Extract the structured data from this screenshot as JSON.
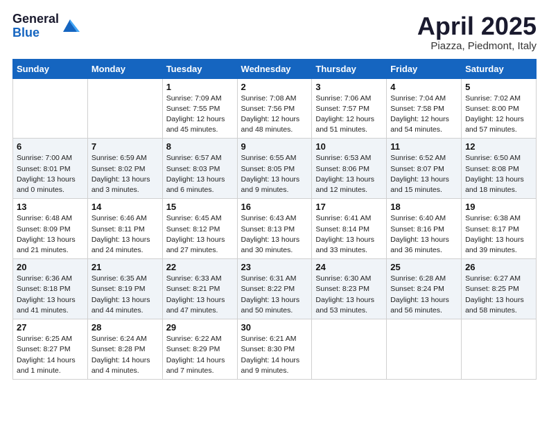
{
  "header": {
    "logo_general": "General",
    "logo_blue": "Blue",
    "title": "April 2025",
    "location": "Piazza, Piedmont, Italy"
  },
  "days_of_week": [
    "Sunday",
    "Monday",
    "Tuesday",
    "Wednesday",
    "Thursday",
    "Friday",
    "Saturday"
  ],
  "weeks": [
    [
      {
        "day": "",
        "info": ""
      },
      {
        "day": "",
        "info": ""
      },
      {
        "day": "1",
        "info": "Sunrise: 7:09 AM\nSunset: 7:55 PM\nDaylight: 12 hours and 45 minutes."
      },
      {
        "day": "2",
        "info": "Sunrise: 7:08 AM\nSunset: 7:56 PM\nDaylight: 12 hours and 48 minutes."
      },
      {
        "day": "3",
        "info": "Sunrise: 7:06 AM\nSunset: 7:57 PM\nDaylight: 12 hours and 51 minutes."
      },
      {
        "day": "4",
        "info": "Sunrise: 7:04 AM\nSunset: 7:58 PM\nDaylight: 12 hours and 54 minutes."
      },
      {
        "day": "5",
        "info": "Sunrise: 7:02 AM\nSunset: 8:00 PM\nDaylight: 12 hours and 57 minutes."
      }
    ],
    [
      {
        "day": "6",
        "info": "Sunrise: 7:00 AM\nSunset: 8:01 PM\nDaylight: 13 hours and 0 minutes."
      },
      {
        "day": "7",
        "info": "Sunrise: 6:59 AM\nSunset: 8:02 PM\nDaylight: 13 hours and 3 minutes."
      },
      {
        "day": "8",
        "info": "Sunrise: 6:57 AM\nSunset: 8:03 PM\nDaylight: 13 hours and 6 minutes."
      },
      {
        "day": "9",
        "info": "Sunrise: 6:55 AM\nSunset: 8:05 PM\nDaylight: 13 hours and 9 minutes."
      },
      {
        "day": "10",
        "info": "Sunrise: 6:53 AM\nSunset: 8:06 PM\nDaylight: 13 hours and 12 minutes."
      },
      {
        "day": "11",
        "info": "Sunrise: 6:52 AM\nSunset: 8:07 PM\nDaylight: 13 hours and 15 minutes."
      },
      {
        "day": "12",
        "info": "Sunrise: 6:50 AM\nSunset: 8:08 PM\nDaylight: 13 hours and 18 minutes."
      }
    ],
    [
      {
        "day": "13",
        "info": "Sunrise: 6:48 AM\nSunset: 8:09 PM\nDaylight: 13 hours and 21 minutes."
      },
      {
        "day": "14",
        "info": "Sunrise: 6:46 AM\nSunset: 8:11 PM\nDaylight: 13 hours and 24 minutes."
      },
      {
        "day": "15",
        "info": "Sunrise: 6:45 AM\nSunset: 8:12 PM\nDaylight: 13 hours and 27 minutes."
      },
      {
        "day": "16",
        "info": "Sunrise: 6:43 AM\nSunset: 8:13 PM\nDaylight: 13 hours and 30 minutes."
      },
      {
        "day": "17",
        "info": "Sunrise: 6:41 AM\nSunset: 8:14 PM\nDaylight: 13 hours and 33 minutes."
      },
      {
        "day": "18",
        "info": "Sunrise: 6:40 AM\nSunset: 8:16 PM\nDaylight: 13 hours and 36 minutes."
      },
      {
        "day": "19",
        "info": "Sunrise: 6:38 AM\nSunset: 8:17 PM\nDaylight: 13 hours and 39 minutes."
      }
    ],
    [
      {
        "day": "20",
        "info": "Sunrise: 6:36 AM\nSunset: 8:18 PM\nDaylight: 13 hours and 41 minutes."
      },
      {
        "day": "21",
        "info": "Sunrise: 6:35 AM\nSunset: 8:19 PM\nDaylight: 13 hours and 44 minutes."
      },
      {
        "day": "22",
        "info": "Sunrise: 6:33 AM\nSunset: 8:21 PM\nDaylight: 13 hours and 47 minutes."
      },
      {
        "day": "23",
        "info": "Sunrise: 6:31 AM\nSunset: 8:22 PM\nDaylight: 13 hours and 50 minutes."
      },
      {
        "day": "24",
        "info": "Sunrise: 6:30 AM\nSunset: 8:23 PM\nDaylight: 13 hours and 53 minutes."
      },
      {
        "day": "25",
        "info": "Sunrise: 6:28 AM\nSunset: 8:24 PM\nDaylight: 13 hours and 56 minutes."
      },
      {
        "day": "26",
        "info": "Sunrise: 6:27 AM\nSunset: 8:25 PM\nDaylight: 13 hours and 58 minutes."
      }
    ],
    [
      {
        "day": "27",
        "info": "Sunrise: 6:25 AM\nSunset: 8:27 PM\nDaylight: 14 hours and 1 minute."
      },
      {
        "day": "28",
        "info": "Sunrise: 6:24 AM\nSunset: 8:28 PM\nDaylight: 14 hours and 4 minutes."
      },
      {
        "day": "29",
        "info": "Sunrise: 6:22 AM\nSunset: 8:29 PM\nDaylight: 14 hours and 7 minutes."
      },
      {
        "day": "30",
        "info": "Sunrise: 6:21 AM\nSunset: 8:30 PM\nDaylight: 14 hours and 9 minutes."
      },
      {
        "day": "",
        "info": ""
      },
      {
        "day": "",
        "info": ""
      },
      {
        "day": "",
        "info": ""
      }
    ]
  ]
}
